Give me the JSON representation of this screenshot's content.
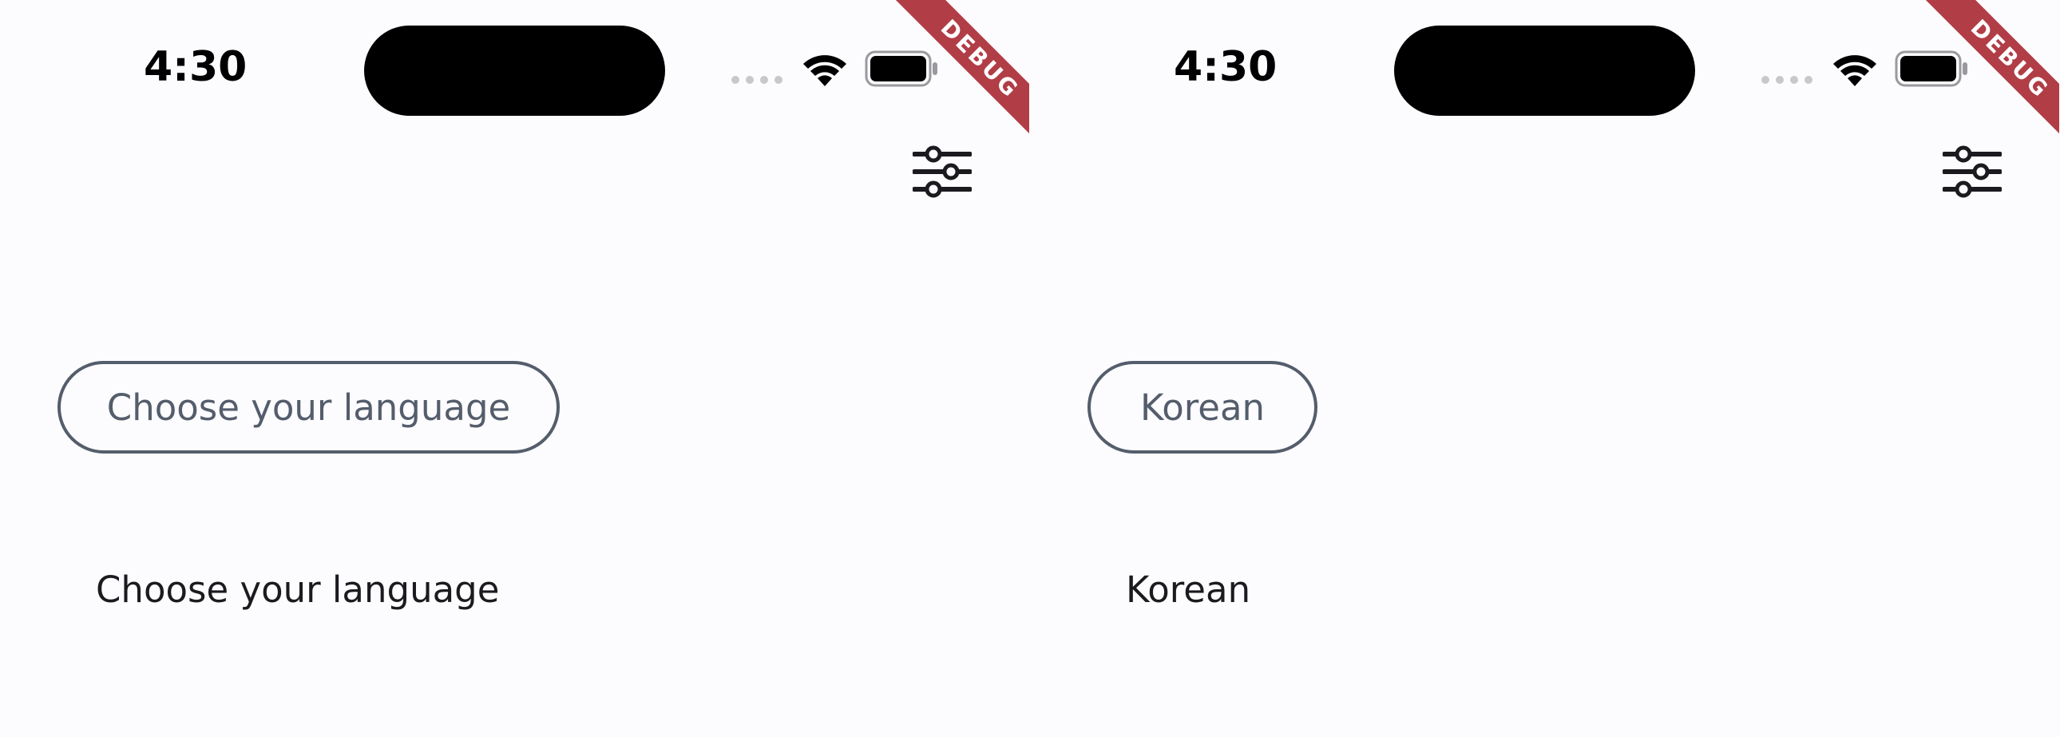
{
  "screens": [
    {
      "status_bar": {
        "time": "4:30",
        "debug_label": "DEBUG"
      },
      "toolbar": {
        "settings_icon": "tune-sliders-icon"
      },
      "language_button": {
        "label": "Choose your language"
      },
      "selected_language_text": "Choose your language"
    },
    {
      "status_bar": {
        "time": "4:30",
        "debug_label": "DEBUG"
      },
      "toolbar": {
        "settings_icon": "tune-sliders-icon"
      },
      "language_button": {
        "label": "Korean"
      },
      "selected_language_text": "Korean"
    }
  ],
  "colors": {
    "background": "#fcfbfe",
    "button_outline": "#545d6b",
    "text": "#1b1b1f",
    "debug_banner": "#b13d46"
  }
}
